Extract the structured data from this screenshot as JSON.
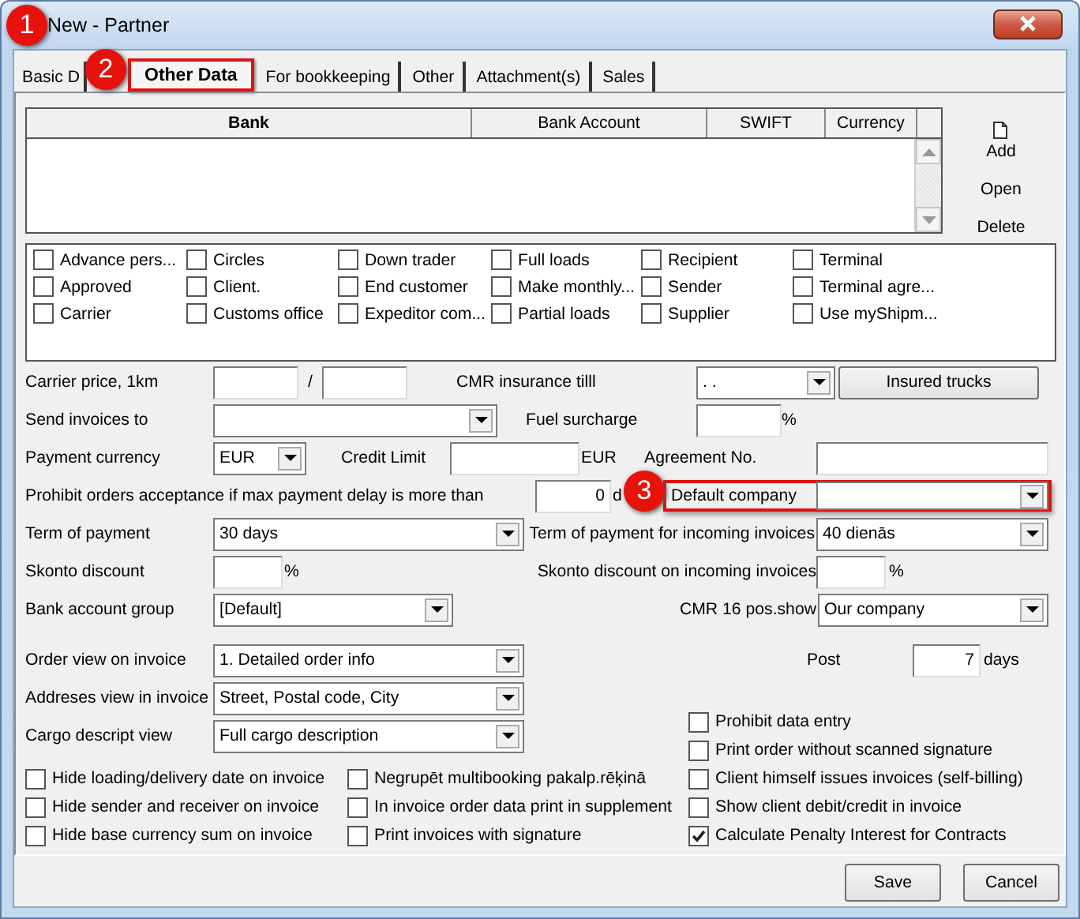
{
  "window": {
    "title": "New - Partner"
  },
  "callouts": [
    {
      "text": "1"
    },
    {
      "text": "2"
    },
    {
      "text": "3"
    }
  ],
  "tabs": [
    {
      "label": "Basic D",
      "selected": false,
      "highlighted": false
    },
    {
      "label": "Other Data",
      "selected": true,
      "highlighted": true
    },
    {
      "label": "For bookkeeping",
      "selected": false,
      "highlighted": false
    },
    {
      "label": "Other",
      "selected": false,
      "highlighted": false
    },
    {
      "label": "Attachment(s)",
      "selected": false,
      "highlighted": false
    },
    {
      "label": "Sales",
      "selected": false,
      "highlighted": false
    }
  ],
  "bank_table": {
    "columns": [
      "Bank",
      "Bank Account",
      "SWIFT",
      "Currency"
    ]
  },
  "bank_buttons": [
    {
      "kind": "add",
      "label": "Add"
    },
    {
      "kind": "plain",
      "label": "Open"
    },
    {
      "kind": "plain",
      "label": "Delete"
    }
  ],
  "partner_types": [
    {
      "label": "Advance pers...",
      "checked": false
    },
    {
      "label": "Circles",
      "checked": false
    },
    {
      "label": "Down trader",
      "checked": false
    },
    {
      "label": "Full loads",
      "checked": false
    },
    {
      "label": "Recipient",
      "checked": false
    },
    {
      "label": "Terminal",
      "checked": false
    },
    {
      "label": "Approved",
      "checked": false
    },
    {
      "label": "Client.",
      "checked": false
    },
    {
      "label": "End customer",
      "checked": false
    },
    {
      "label": "Make monthly...",
      "checked": false
    },
    {
      "label": "Sender",
      "checked": false
    },
    {
      "label": "Terminal agre...",
      "checked": false
    },
    {
      "label": "Carrier",
      "checked": false
    },
    {
      "label": "Customs office",
      "checked": false
    },
    {
      "label": "Expeditor com...",
      "checked": false
    },
    {
      "label": "Partial loads",
      "checked": false
    },
    {
      "label": "Supplier",
      "checked": false
    },
    {
      "label": "Use myShipm...",
      "checked": false
    }
  ],
  "carrier_price": {
    "label": "Carrier price, 1km",
    "separator": "/"
  },
  "cmr_insurance": {
    "label": "CMR insurance tilll",
    "value": ". ."
  },
  "insured_trucks_button": "Insured trucks",
  "send_invoices_to": {
    "label": "Send invoices to"
  },
  "fuel_surcharge": {
    "label": "Fuel surcharge",
    "unit": "%"
  },
  "payment_currency": {
    "label": "Payment currency",
    "value": "EUR"
  },
  "credit_limit": {
    "label": "Credit Limit",
    "unit": "EUR"
  },
  "agreement_no": {
    "label": "Agreement No."
  },
  "max_payment_delay": {
    "label": "Prohibit orders acceptance if max payment delay is more than",
    "value": "0",
    "unit": "d"
  },
  "default_company": {
    "label": "Default company",
    "highlighted": true
  },
  "term_of_payment": {
    "label": "Term of payment",
    "value": "30 days"
  },
  "term_incoming": {
    "label": "Term of payment for incoming invoices",
    "value": "40 dienās"
  },
  "skonto_discount": {
    "label": "Skonto discount",
    "unit": "%"
  },
  "skonto_incoming": {
    "label": "Skonto discount on incoming invoices",
    "unit": "%"
  },
  "bank_account_group": {
    "label": "Bank account group",
    "value": "[Default]"
  },
  "cmr16": {
    "label": "CMR 16 pos.show",
    "value": "Our company"
  },
  "order_view": {
    "label": "Order view on invoice",
    "value": "1. Detailed order info"
  },
  "post": {
    "label": "Post",
    "value": "7",
    "unit": "days"
  },
  "addresses_view": {
    "label": "Addreses view in invoice",
    "value": "Street, Postal code, City"
  },
  "cargo_view": {
    "label": "Cargo descript view",
    "value": "Full cargo description"
  },
  "options_left": [
    {
      "label": "Hide loading/delivery date on invoice",
      "checked": false
    },
    {
      "label": "Hide sender and receiver on invoice",
      "checked": false
    },
    {
      "label": "Hide base currency sum on invoice",
      "checked": false
    }
  ],
  "options_middle": [
    {
      "label": "Negrupēt multibooking pakalp.rēķinā",
      "checked": false
    },
    {
      "label": "In invoice order data print in supplement",
      "checked": false
    },
    {
      "label": "Print invoices with signature",
      "checked": false
    }
  ],
  "options_right": [
    {
      "label": "Prohibit data entry",
      "checked": false
    },
    {
      "label": "Print order without scanned signature",
      "checked": false
    },
    {
      "label": "Client himself issues invoices (self-billing)",
      "checked": false
    },
    {
      "label": "Show client debit/credit in invoice",
      "checked": false
    },
    {
      "label": "Calculate Penalty Interest for Contracts",
      "checked": true
    }
  ],
  "buttons": [
    "Save",
    "Cancel"
  ]
}
